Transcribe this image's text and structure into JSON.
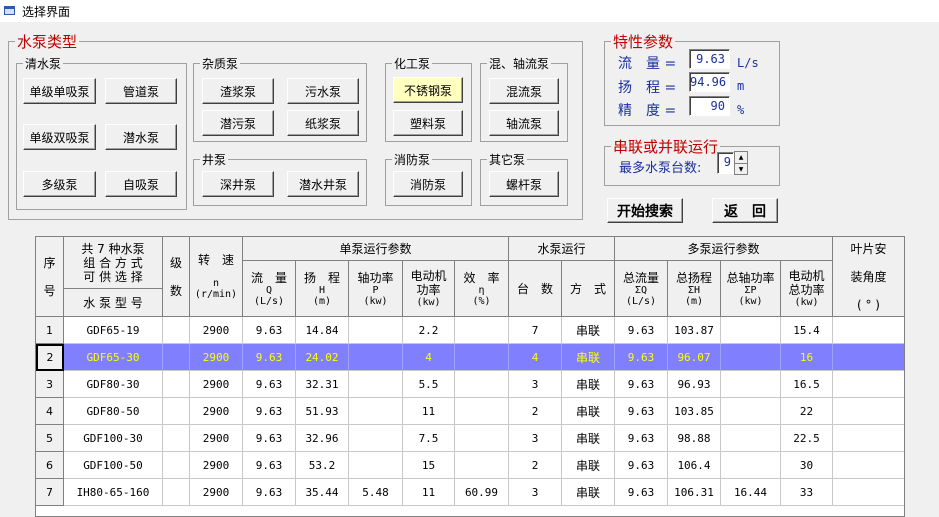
{
  "window": {
    "title": "选择界面"
  },
  "pump_types": {
    "legend": "水泵类型",
    "clean": {
      "legend": "清水泵",
      "buttons": [
        "单级单吸泵",
        "管道泵",
        "单级双吸泵",
        "潜水泵",
        "多级泵",
        "自吸泵"
      ]
    },
    "impurity": {
      "legend": "杂质泵",
      "buttons": [
        "渣浆泵",
        "污水泵",
        "潜污泵",
        "纸浆泵"
      ]
    },
    "chemical": {
      "legend": "化工泵",
      "buttons": [
        "不锈钢泵",
        "塑料泵"
      ]
    },
    "mixed": {
      "legend": "混、轴流泵",
      "buttons": [
        "混流泵",
        "轴流泵"
      ]
    },
    "well": {
      "legend": "井泵",
      "buttons": [
        "深井泵",
        "潜水井泵"
      ]
    },
    "fire": {
      "legend": "消防泵",
      "buttons": [
        "消防泵"
      ]
    },
    "other": {
      "legend": "其它泵",
      "buttons": [
        "螺杆泵"
      ]
    }
  },
  "params": {
    "legend": "特性参数",
    "flow": {
      "label": "流　量 =",
      "value": "9.63",
      "unit": "L/s"
    },
    "head": {
      "label": "扬　程 =",
      "value": "94.96",
      "unit": "m"
    },
    "precision": {
      "label": "精　度 =",
      "value": "90",
      "unit": "%"
    }
  },
  "series": {
    "legend": "串联或并联运行",
    "label": "最多水泵台数:",
    "value": "9"
  },
  "actions": {
    "search": "开始搜索",
    "back": "返　回"
  },
  "table": {
    "headers": {
      "seq": "序\n\n号",
      "combo": "共 7 种水泵\n组 合 方 式\n可 供 选 择",
      "model": "水 泵 型 号",
      "stage": "级\n\n数",
      "speed": "转　速\n\nn\n(r/min)",
      "single_group": "单泵运行参数",
      "pump_run_group": "水泵运行",
      "multi_group": "多泵运行参数",
      "blade": "叶片安\n\n装角度\n\n( ° )",
      "cols": [
        {
          "top": "流　量",
          "sym": "Q",
          "unit": "(L/s)"
        },
        {
          "top": "扬　程",
          "sym": "H",
          "unit": "(m)"
        },
        {
          "top": "轴功率",
          "sym": "P",
          "unit": "(kw)"
        },
        {
          "top": "电动机\n功率",
          "sym": "",
          "unit": "(kw)"
        },
        {
          "top": "效　率",
          "sym": "η",
          "unit": "(%)"
        },
        {
          "top": "台　数",
          "sym": "",
          "unit": ""
        },
        {
          "top": "方　式",
          "sym": "",
          "unit": ""
        },
        {
          "top": "总流量",
          "sym": "ΣQ",
          "unit": "(L/s)"
        },
        {
          "top": "总扬程",
          "sym": "ΣH",
          "unit": "(m)"
        },
        {
          "top": "总轴功率",
          "sym": "ΣP",
          "unit": "(kw)"
        },
        {
          "top": "电动机\n总功率",
          "sym": "",
          "unit": "(kw)"
        }
      ]
    },
    "rows": [
      [
        "1",
        "GDF65-19",
        "",
        "2900",
        "9.63",
        "14.84",
        "",
        "2.2",
        "",
        "7",
        "串联",
        "9.63",
        "103.87",
        "",
        "15.4",
        ""
      ],
      [
        "2",
        "GDF65-30",
        "",
        "2900",
        "9.63",
        "24.02",
        "",
        "4",
        "",
        "4",
        "串联",
        "9.63",
        "96.07",
        "",
        "16",
        ""
      ],
      [
        "3",
        "GDF80-30",
        "",
        "2900",
        "9.63",
        "32.31",
        "",
        "5.5",
        "",
        "3",
        "串联",
        "9.63",
        "96.93",
        "",
        "16.5",
        ""
      ],
      [
        "4",
        "GDF80-50",
        "",
        "2900",
        "9.63",
        "51.93",
        "",
        "11",
        "",
        "2",
        "串联",
        "9.63",
        "103.85",
        "",
        "22",
        ""
      ],
      [
        "5",
        "GDF100-30",
        "",
        "2900",
        "9.63",
        "32.96",
        "",
        "7.5",
        "",
        "3",
        "串联",
        "9.63",
        "98.88",
        "",
        "22.5",
        ""
      ],
      [
        "6",
        "GDF100-50",
        "",
        "2900",
        "9.63",
        "53.2",
        "",
        "15",
        "",
        "2",
        "串联",
        "9.63",
        "106.4",
        "",
        "30",
        ""
      ],
      [
        "7",
        "IH80-65-160",
        "",
        "2900",
        "9.63",
        "35.44",
        "5.48",
        "11",
        "60.99",
        "3",
        "串联",
        "9.63",
        "106.31",
        "16.44",
        "33",
        ""
      ]
    ],
    "selected_row": 1
  },
  "colors": {
    "selection_bg": "#8080ff",
    "selection_fg": "#ffff00",
    "legend_red": "#c00000",
    "param_blue": "#1a2fa0"
  }
}
